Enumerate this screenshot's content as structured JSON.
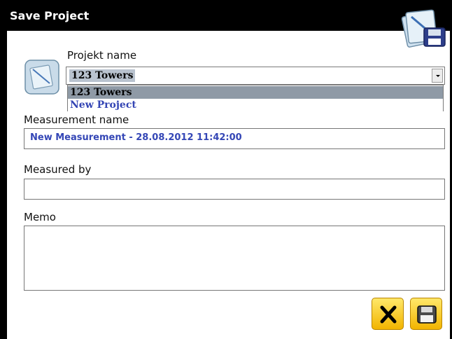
{
  "window": {
    "title": "Save Project"
  },
  "project": {
    "label": "Projekt name",
    "selected": "123 Towers",
    "options": [
      "123 Towers",
      "New Project"
    ]
  },
  "measurement": {
    "label": "Measurement name",
    "value": "New Measurement - 28.08.2012 11:42:00"
  },
  "measured_by": {
    "label": "Measured by",
    "value": ""
  },
  "memo": {
    "label": "Memo",
    "value": ""
  },
  "buttons": {
    "cancel_icon": "close-icon",
    "save_icon": "floppy-disk-icon"
  },
  "colors": {
    "titlebar": "#000000",
    "accent_text": "#3446b6",
    "button": "#f5c000"
  }
}
